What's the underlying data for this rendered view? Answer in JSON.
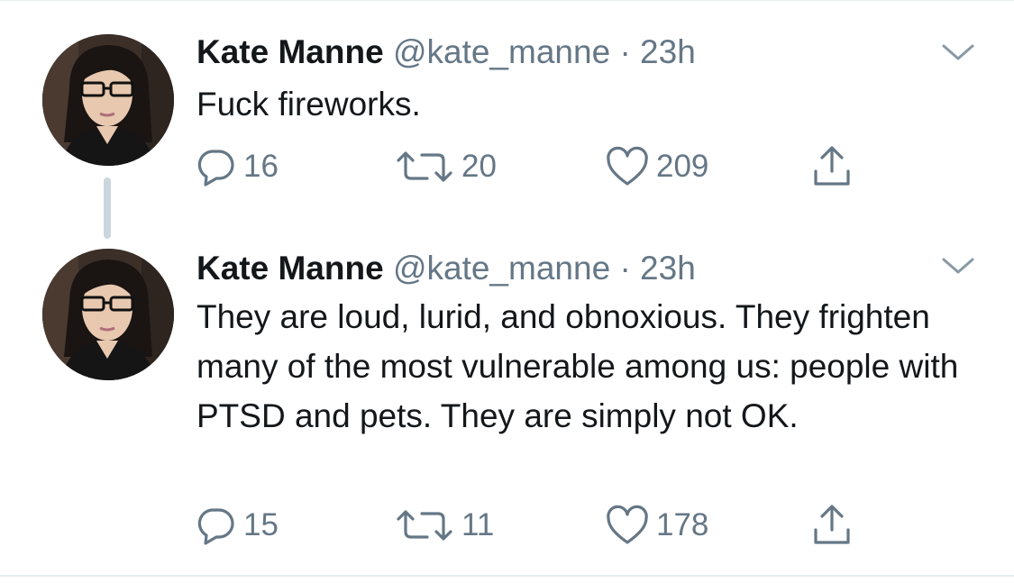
{
  "colors": {
    "text_primary": "#14171a",
    "text_secondary": "#657786",
    "divider": "#e6ecf0",
    "thread_line": "#ccd6dd"
  },
  "tweets": [
    {
      "name": "Kate Manne",
      "handle": "@kate_manne",
      "separator": "·",
      "time": "23h",
      "text": "Fuck fireworks.",
      "reply_count": "16",
      "retweet_count": "20",
      "like_count": "209",
      "icons": [
        "reply-icon",
        "retweet-icon",
        "like-icon",
        "share-icon",
        "chevron-down-icon"
      ]
    },
    {
      "name": "Kate Manne",
      "handle": "@kate_manne",
      "separator": "·",
      "time": "23h",
      "text": "They are loud, lurid, and obnoxious. They frighten many of the most vulnerable among us: people with PTSD and pets. They are simply not OK.",
      "reply_count": "15",
      "retweet_count": "11",
      "like_count": "178",
      "icons": [
        "reply-icon",
        "retweet-icon",
        "like-icon",
        "share-icon",
        "chevron-down-icon"
      ]
    }
  ]
}
